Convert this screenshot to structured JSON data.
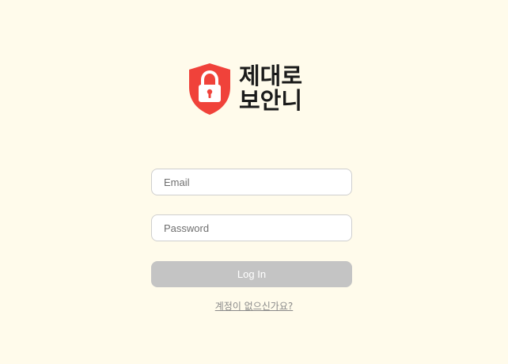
{
  "brand": {
    "line1": "제대로",
    "line2": "보안니",
    "icon": "shield-lock-icon",
    "shield_color": "#f0423a"
  },
  "form": {
    "email_placeholder": "Email",
    "email_value": "",
    "password_placeholder": "Password",
    "password_value": "",
    "login_label": "Log In",
    "login_button_color": "#c4c4c4"
  },
  "signup": {
    "link_text": "계정이 없으신가요?"
  }
}
